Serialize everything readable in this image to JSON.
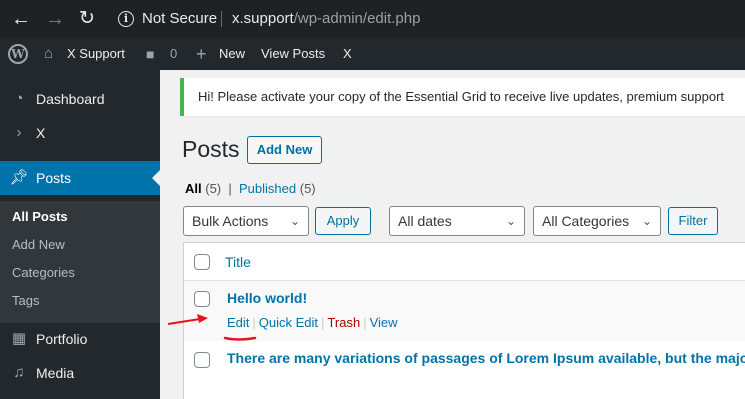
{
  "browser": {
    "security_label": "Not Secure",
    "url_host": "x.support",
    "url_path": "/wp-admin/edit.php"
  },
  "adminbar": {
    "site_name": "X Support",
    "comment_count": "0",
    "new_label": "New",
    "view_posts_label": "View Posts",
    "x_label": "X"
  },
  "sidebar": {
    "items": [
      {
        "label": "Dashboard",
        "icon": "dashboard-icon"
      },
      {
        "label": "X",
        "icon": "chevron-right-icon"
      },
      {
        "label": "Posts",
        "icon": "pushpin-icon"
      },
      {
        "label": "Portfolio",
        "icon": "portfolio-icon"
      },
      {
        "label": "Media",
        "icon": "media-icon"
      }
    ],
    "submenu": [
      "All Posts",
      "Add New",
      "Categories",
      "Tags"
    ]
  },
  "notice": {
    "text": "Hi! Please activate your copy of the Essential Grid to receive live updates, premium support"
  },
  "page": {
    "title": "Posts",
    "add_new_label": "Add New",
    "views": {
      "all_label": "All",
      "all_count": "(5)",
      "separator": "|",
      "published_label": "Published",
      "published_count": "(5)"
    }
  },
  "toolbar": {
    "bulk_actions": "Bulk Actions",
    "apply_label": "Apply",
    "dates": "All dates",
    "categories": "All Categories",
    "filter_label": "Filter"
  },
  "table": {
    "column_title": "Title",
    "rows": [
      {
        "title": "Hello world!",
        "actions": [
          "Edit",
          "Quick Edit",
          "Trash",
          "View"
        ]
      },
      {
        "title": "There are many variations of passages of Lorem Ipsum available, but the majority"
      }
    ]
  },
  "colors": {
    "accent": "#0073aa",
    "annotation": "#e8141c",
    "notice_border": "#46b450",
    "trash": "#aa0000"
  }
}
